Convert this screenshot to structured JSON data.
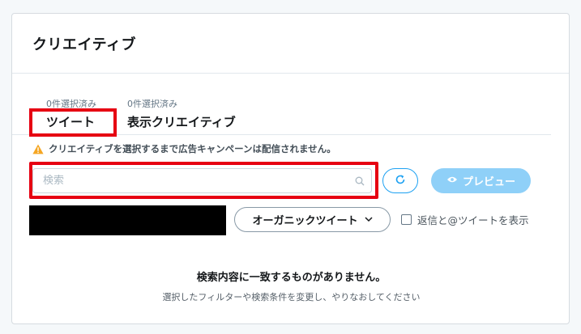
{
  "card": {
    "title": "クリエイティブ"
  },
  "tabs": [
    {
      "count": "0件選択済み",
      "label": "ツイート"
    },
    {
      "count": "0件選択済み",
      "label": "表示クリエイティブ"
    }
  ],
  "warning": {
    "text": "クリエイティブを選択するまで広告キャンペーンは配信されません。",
    "icon": "warning-icon",
    "color": "#f5a623"
  },
  "search": {
    "placeholder": "検索",
    "value": ""
  },
  "toolbar": {
    "refresh_icon": "refresh-icon",
    "preview_label": "プレビュー"
  },
  "filter": {
    "organic_label": "オーガニックツイート",
    "show_replies_label": "返信と@ツイートを表示",
    "show_replies_checked": false
  },
  "empty_state": {
    "title": "検索内容に一致するものがありません。",
    "subtitle": "選択したフィルターや検索条件を変更し、やりなおしてください"
  },
  "colors": {
    "accent": "#1da1f2",
    "preview_disabled": "#8fd0f8",
    "highlight": "#e60012"
  }
}
